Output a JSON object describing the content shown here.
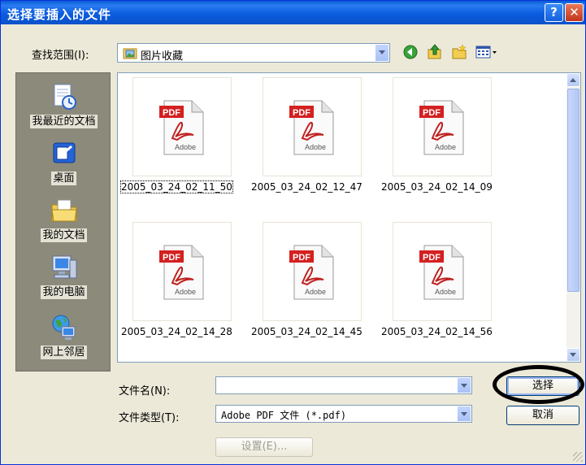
{
  "window": {
    "title": "选择要插入的文件",
    "help_label": "?",
    "close_label": "✕"
  },
  "lookin": {
    "label": "查找范围(I):",
    "value": "图片收藏"
  },
  "places": [
    {
      "label": "我最近的文档",
      "icon": "recent-documents-icon"
    },
    {
      "label": "桌面",
      "icon": "desktop-icon"
    },
    {
      "label": "我的文档",
      "icon": "my-documents-icon"
    },
    {
      "label": "我的电脑",
      "icon": "my-computer-icon"
    },
    {
      "label": "网上邻居",
      "icon": "network-places-icon"
    }
  ],
  "files": [
    {
      "name": "2005_03_24_02_11_50",
      "icon": "pdf-file-icon",
      "badge": "PDF",
      "brand": "Adobe",
      "selected": true
    },
    {
      "name": "2005_03_24_02_12_47",
      "icon": "pdf-file-icon",
      "badge": "PDF",
      "brand": "Adobe",
      "selected": false
    },
    {
      "name": "2005_03_24_02_14_09",
      "icon": "pdf-file-icon",
      "badge": "PDF",
      "brand": "Adobe",
      "selected": false
    },
    {
      "name": "2005_03_24_02_14_28",
      "icon": "pdf-file-icon",
      "badge": "PDF",
      "brand": "Adobe",
      "selected": false
    },
    {
      "name": "2005_03_24_02_14_45",
      "icon": "pdf-file-icon",
      "badge": "PDF",
      "brand": "Adobe",
      "selected": false
    },
    {
      "name": "2005_03_24_02_14_56",
      "icon": "pdf-file-icon",
      "badge": "PDF",
      "brand": "Adobe",
      "selected": false
    }
  ],
  "filename": {
    "label": "文件名(N):",
    "value": ""
  },
  "filetype": {
    "label": "文件类型(T):",
    "value": "Adobe PDF 文件 (*.pdf)"
  },
  "buttons": {
    "select": "选择",
    "cancel": "取消",
    "settings": "设置(E)..."
  },
  "colors": {
    "titlebar": "#0a5bd8",
    "dialog_bg": "#ece9d8",
    "pdf_red": "#d42020"
  }
}
